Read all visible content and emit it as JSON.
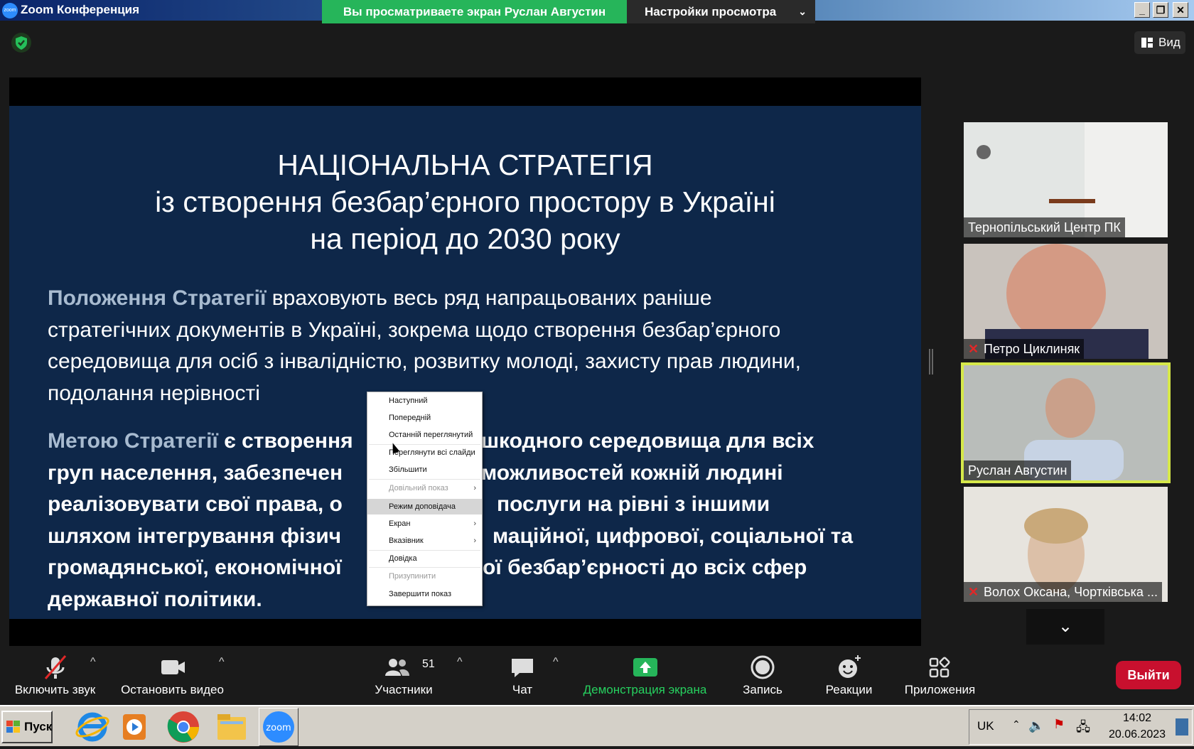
{
  "window": {
    "title": "Zoom Конференция",
    "icon_text": "zoom"
  },
  "share_banner": {
    "text": "Вы просматриваете экран Руслан Августин",
    "view_options": "Настройки просмотра"
  },
  "top_bar": {
    "view_button": "Вид"
  },
  "slide": {
    "title_lines": [
      "НАЦІОНАЛЬНА СТРАТЕГІЯ",
      "із створення безбар’єрного простору в Україні",
      "на період до 2030 року"
    ],
    "paragraph1": {
      "highlight": "Положення Стратегії",
      "lines": [
        " враховують весь ряд напрацьованих раніше",
        "стратегічних документів в Україні, зокрема щодо створення безбар’єрного",
        "середовища для осіб з інвалідністю, розвитку молоді, захисту прав людини,",
        "подолання нерівності"
      ]
    },
    "paragraph2": {
      "highlight": "Метою Стратегії",
      "lines": [
        " є створення",
        "шкодного середовища для всіх",
        "груп населення, забезпечен",
        "можливостей кожній людині",
        "реалізовувати свої права, о",
        "послуги на рівні з іншими",
        "шляхом інтегрування фізич",
        "мацiйної, цифрової, соціальної та",
        "громадянської, економічної",
        "ої безбар’єрності до всіх сфер",
        "державної політики."
      ]
    }
  },
  "context_menu": {
    "items": [
      {
        "label": "Наступний",
        "disabled": false
      },
      {
        "label": "Попередній",
        "disabled": false
      },
      {
        "label": "Останній переглянутий",
        "disabled": false
      },
      {
        "label": "Переглянути всі слайди",
        "disabled": false
      },
      {
        "label": "Збільшити",
        "disabled": false
      },
      {
        "label": "Довільний показ",
        "disabled": true,
        "submenu": true
      },
      {
        "label": "Режим доповідача",
        "disabled": false,
        "highlighted": true
      },
      {
        "label": "Екран",
        "disabled": false,
        "submenu": true
      },
      {
        "label": "Вказівник",
        "disabled": false,
        "submenu": true
      },
      {
        "label": "Довідка",
        "disabled": false
      },
      {
        "label": "Призупинити",
        "disabled": true
      },
      {
        "label": "Завершити показ",
        "disabled": false
      }
    ]
  },
  "participants": [
    {
      "name": "Тернопільський Центр ПК",
      "muted": false
    },
    {
      "name": "Петро Циклиняк",
      "muted": true
    },
    {
      "name": "Руслан Августин",
      "muted": false,
      "active": true
    },
    {
      "name": "Волох Оксана, Чортківська ...",
      "muted": true
    }
  ],
  "toolbar": {
    "unmute": "Включить звук",
    "stop_video": "Остановить видео",
    "participants": "Участники",
    "participants_count": "51",
    "chat": "Чат",
    "share_screen": "Демонстрация экрана",
    "record": "Запись",
    "reactions": "Реакции",
    "apps": "Приложения",
    "leave": "Выйти"
  },
  "taskbar": {
    "start": "Пуск",
    "language": "UK",
    "time": "14:02",
    "date": "20.06.2023"
  },
  "colors": {
    "slide_bg": "#0e2749",
    "share_green": "#26b55a",
    "active_border": "#d6e84a",
    "leave_red": "#c8102e"
  }
}
